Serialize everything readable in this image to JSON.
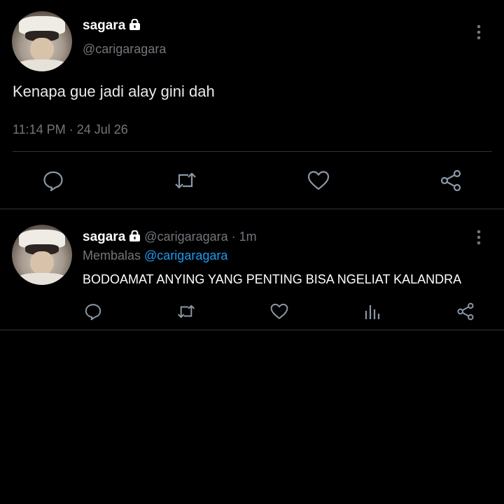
{
  "main_tweet": {
    "display_name": "sagara",
    "handle": "@carigaragara",
    "text": "Kenapa gue jadi alay gini dah",
    "timestamp": "11:14 PM · 24 Jul 26",
    "icons": [
      "lock-icon",
      "more-vertical-icon",
      "reply-icon",
      "retweet-icon",
      "like-icon",
      "share-icon"
    ]
  },
  "reply_tweet": {
    "display_name": "sagara",
    "handle": "@carigaragara",
    "time_sep": " · ",
    "age": "1m",
    "replying_prefix": "Membalas ",
    "replying_to": "@carigaragara",
    "text": "BODOAMAT ANYING YANG PENTING BISA NGELIAT KALANDRA",
    "icons": [
      "lock-icon",
      "more-vertical-icon",
      "reply-icon",
      "retweet-icon",
      "like-icon",
      "views-icon",
      "share-icon"
    ]
  },
  "colors": {
    "background": "#000000",
    "text": "#e7e9ea",
    "muted": "#71767b",
    "link": "#1d9bf0",
    "divider": "#2f3336"
  }
}
